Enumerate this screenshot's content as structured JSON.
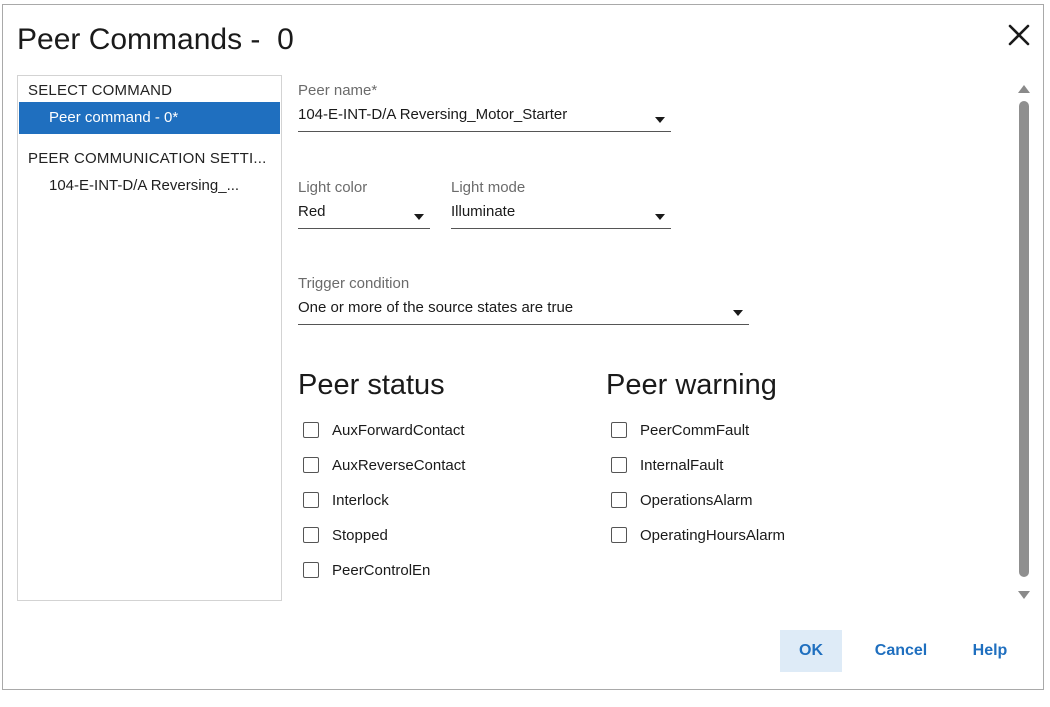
{
  "dialog": {
    "title": "Peer Commands -  0"
  },
  "nav": {
    "select_heading": "SELECT COMMAND",
    "select_item": "Peer command - 0*",
    "peer_heading": "PEER COMMUNICATION SETTI...",
    "peer_item": "104-E-INT-D/A Reversing_..."
  },
  "form": {
    "peer_name_label": "Peer name*",
    "peer_name_value": "104-E-INT-D/A Reversing_Motor_Starter",
    "light_color_label": "Light color",
    "light_color_value": "Red",
    "light_mode_label": "Light mode",
    "light_mode_value": "Illuminate",
    "trigger_label": "Trigger condition",
    "trigger_value": "One or more of the source states are true"
  },
  "peer_status": {
    "title": "Peer status",
    "items": [
      "AuxForwardContact",
      "AuxReverseContact",
      "Interlock",
      "Stopped",
      "PeerControlEn"
    ]
  },
  "peer_warning": {
    "title": "Peer warning",
    "items": [
      "PeerCommFault",
      "InternalFault",
      "OperationsAlarm",
      "OperatingHoursAlarm"
    ]
  },
  "buttons": {
    "ok": "OK",
    "cancel": "Cancel",
    "help": "Help"
  },
  "colors": {
    "accent": "#1f6fbf",
    "ok_background": "#deebf7"
  }
}
